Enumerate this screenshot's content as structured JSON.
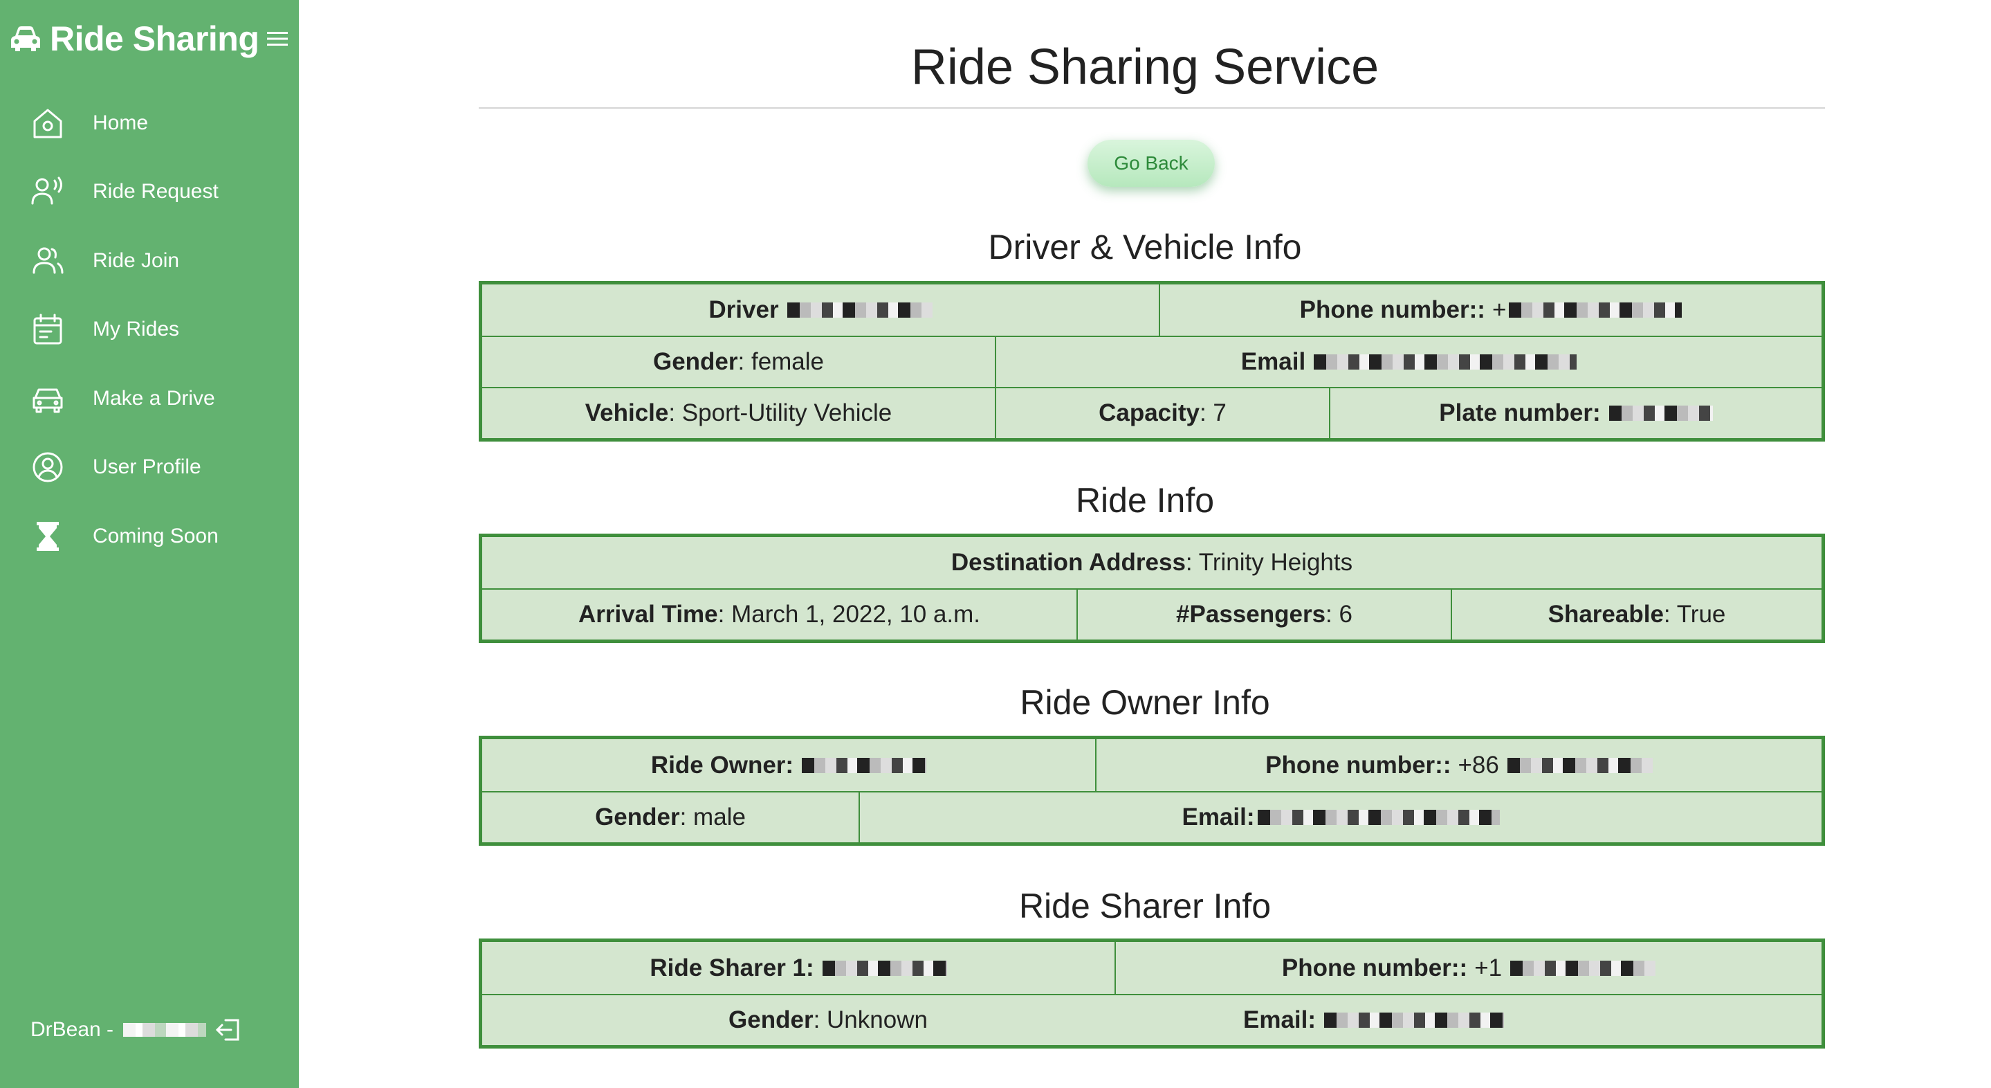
{
  "sidebar": {
    "brand": "Ride Sharing",
    "items": [
      {
        "label": "Home",
        "icon": "home-icon"
      },
      {
        "label": "Ride Request",
        "icon": "voice-user-icon"
      },
      {
        "label": "Ride Join",
        "icon": "users-icon"
      },
      {
        "label": "My Rides",
        "icon": "calendar-icon"
      },
      {
        "label": "Make a Drive",
        "icon": "car-icon"
      },
      {
        "label": "User Profile",
        "icon": "user-circle-icon"
      },
      {
        "label": "Coming Soon",
        "icon": "hourglass-icon"
      }
    ],
    "footer_user": "DrBean -"
  },
  "main": {
    "title": "Ride Sharing Service",
    "go_back": "Go Back",
    "driver": {
      "title": "Driver & Vehicle Info",
      "driver_label": "Driver",
      "phone_label": "Phone number::",
      "phone_prefix": "+",
      "gender_label": "Gender",
      "gender_value": ": female",
      "email_label": "Email",
      "vehicle_label": "Vehicle",
      "vehicle_value": ": Sport-Utility Vehicle",
      "capacity_label": "Capacity",
      "capacity_value": ": 7",
      "plate_label": "Plate number:"
    },
    "ride": {
      "title": "Ride Info",
      "dest_label": "Destination Address",
      "dest_value": ": Trinity Heights",
      "arrival_label": "Arrival Time",
      "arrival_value": ": March 1, 2022, 10 a.m.",
      "passengers_label": "#Passengers",
      "passengers_value": ": 6",
      "shareable_label": "Shareable",
      "shareable_value": ": True"
    },
    "owner": {
      "title": "Ride Owner Info",
      "owner_label": "Ride Owner:",
      "phone_label": "Phone number::",
      "phone_prefix": "+86",
      "gender_label": "Gender",
      "gender_value": ": male",
      "email_label": "Email:"
    },
    "sharer": {
      "title": "Ride Sharer Info",
      "sharer_label": "Ride Sharer 1:",
      "phone_label": "Phone number::",
      "phone_prefix": "+1",
      "gender_label": "Gender",
      "gender_value": ": Unknown",
      "email_label": "Email:"
    }
  },
  "colors": {
    "sidebar_bg": "#63b270",
    "table_border": "#3f8f3c",
    "table_bg": "#d4e6cf",
    "button_text": "#2d8a3a"
  }
}
